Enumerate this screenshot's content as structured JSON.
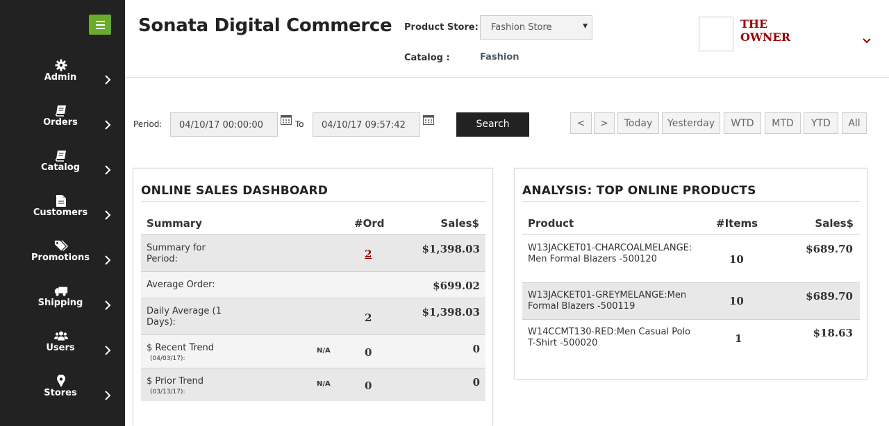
{
  "sidebar": {
    "items": [
      {
        "label": "Admin",
        "icon": "gear-icon"
      },
      {
        "label": "Orders",
        "icon": "book-icon"
      },
      {
        "label": "Catalog",
        "icon": "book-icon"
      },
      {
        "label": "Customers",
        "icon": "document-icon"
      },
      {
        "label": "Promotions",
        "icon": "tags-icon"
      },
      {
        "label": "Shipping",
        "icon": "truck-icon"
      },
      {
        "label": "Users",
        "icon": "users-icon"
      },
      {
        "label": "Stores",
        "icon": "map-marker-icon"
      }
    ]
  },
  "header": {
    "title": "Sonata Digital Commerce",
    "product_store_label": "Product Store:",
    "product_store_value": "Fashion Store",
    "catalog_label": "Catalog :",
    "catalog_value": "Fashion",
    "user_name_line1": "THE",
    "user_name_line2": "OWNER"
  },
  "filters": {
    "period_label": "Period:",
    "from_value": "04/10/17 00:00:00",
    "to_label": "To",
    "to_value": "04/10/17 09:57:42",
    "search_label": "Search",
    "range_buttons": [
      "<",
      ">",
      "Today",
      "Yesterday",
      "WTD",
      "MTD",
      "YTD",
      "All"
    ]
  },
  "sales_dashboard": {
    "title": "ONLINE SALES DASHBOARD",
    "columns": {
      "summary": "Summary",
      "orders": "#Ord",
      "sales": "Sales$"
    },
    "rows": [
      {
        "label": "Summary for Period:",
        "sub": "",
        "na": "",
        "orders": "2",
        "sales": "$1,398.03"
      },
      {
        "label": "Average Order:",
        "sub": "",
        "na": "",
        "orders": "",
        "sales": "$699.02"
      },
      {
        "label": "Daily Average (1 Days):",
        "sub": "",
        "na": "",
        "orders": "2",
        "sales": "$1,398.03"
      },
      {
        "label": "$ Recent Trend",
        "sub": "(04/03/17):",
        "na": "N/A",
        "orders": "0",
        "sales": "0"
      },
      {
        "label": "$ Prior Trend",
        "sub": "(03/13/17):",
        "na": "N/A",
        "orders": "0",
        "sales": "0"
      }
    ]
  },
  "top_products": {
    "title": "ANALYSIS: TOP ONLINE PRODUCTS",
    "columns": {
      "product": "Product",
      "items": "#Items",
      "sales": "Sales$"
    },
    "rows": [
      {
        "product": "W13JACKET01-CHARCOALMELANGE:Men Formal Blazers -500120",
        "items": "10",
        "sales": "$689.70"
      },
      {
        "product": "W13JACKET01-GREYMELANGE:Men Formal Blazers -500119",
        "items": "10",
        "sales": "$689.70"
      },
      {
        "product": "W14CCMT130-RED:Men Casual Polo T-Shirt -500020",
        "items": "1",
        "sales": "$18.63"
      }
    ]
  },
  "colors": {
    "sidebar_bg": "#222222",
    "menu_button": "#6aab2a",
    "accent_red": "#990000"
  }
}
